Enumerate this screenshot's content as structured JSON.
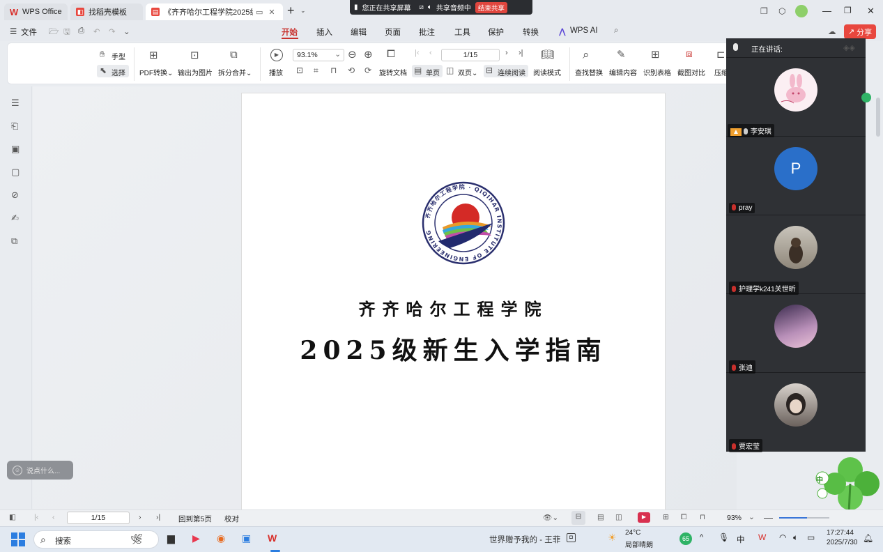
{
  "titlebar": {
    "tabs": [
      {
        "label": "WPS Office",
        "icon": "wps-logo-icon"
      },
      {
        "label": "找稻壳模板",
        "icon": "docer-icon"
      },
      {
        "label": "《齐齐哈尔工程学院2025级新",
        "icon": "pdf-icon"
      }
    ],
    "new_tab": "+",
    "sharing": {
      "status": "您正在共享屏幕",
      "audio": "共享音频中",
      "end": "结束共享"
    }
  },
  "menu": {
    "file": "文件",
    "tabs": [
      "开始",
      "插入",
      "编辑",
      "页面",
      "批注",
      "工具",
      "保护",
      "转换",
      "WPS AI"
    ],
    "active": "开始",
    "share": "分享"
  },
  "ribbon": {
    "hand": "手型",
    "select": "选择",
    "pdf_convert": "PDF转换",
    "export_image": "输出为图片",
    "split_merge": "拆分合并",
    "play": "播放",
    "zoom": "93.1%",
    "page": "1/15",
    "rotate": "旋转文档",
    "single": "单页",
    "double": "双页",
    "continuous": "连续阅读",
    "read_mode": "阅读模式",
    "find_replace": "查找替换",
    "edit_content": "编辑内容",
    "recognize_table": "识别表格",
    "screenshot_compare": "截图对比",
    "compress": "压缩"
  },
  "document": {
    "seal_text": "齐齐哈尔工程学院 · QIQIHAR INSTITUTE OF ENGINEERING",
    "school": "齐齐哈尔工程学院",
    "title": "2025级新生入学指南"
  },
  "chat_placeholder": "说点什么...",
  "meeting": {
    "speaking": "正在讲话:",
    "participants": [
      {
        "name": "李安琪",
        "avatar": "bunny-avatar-icon"
      },
      {
        "name": "pray",
        "avatar": "letter-avatar",
        "letter": "P",
        "color": "#2a6fc9"
      },
      {
        "name": "护理学k241关世昕",
        "avatar": "photo-avatar-icon"
      },
      {
        "name": "张迪",
        "avatar": "anime-avatar-icon"
      },
      {
        "name": "贾宏莹",
        "avatar": "portrait-avatar-icon"
      }
    ]
  },
  "status": {
    "page": "1/15",
    "goto": "回到第5页",
    "proof": "校对",
    "zoom": "93%"
  },
  "taskbar": {
    "search": "搜索",
    "media": "世界赠予我的 - 王菲",
    "weather_temp": "24°C",
    "weather_desc": "局部晴朗",
    "badge": "65",
    "ime": "中",
    "time": "17:27:44",
    "date": "2025/7/30"
  },
  "clover_ime": "中"
}
